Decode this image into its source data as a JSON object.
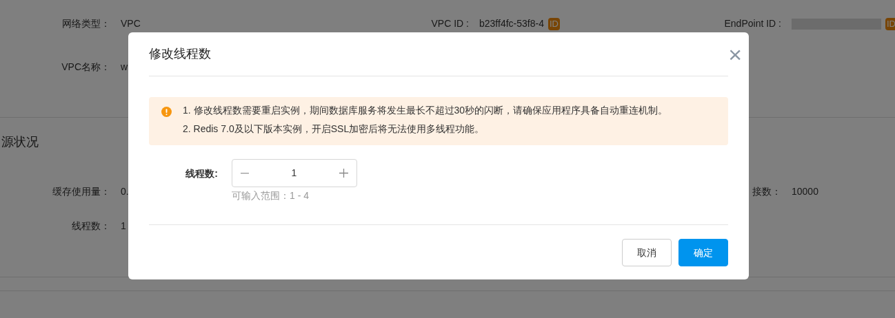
{
  "background": {
    "network_rows": [
      [
        {
          "label": "网络类型：",
          "value": "VPC"
        },
        {
          "label": "VPC ID :",
          "value": "b23ff4fc-53f8-4",
          "badge": "ID"
        },
        {
          "label": "EndPoint ID :",
          "badge": "ID"
        }
      ],
      [
        {
          "label": "VPC名称：",
          "value": "w"
        }
      ]
    ],
    "section_title": "源状况",
    "resource_rows": [
      [
        {
          "label": "缓存使用量：",
          "value": "0."
        },
        {
          "label": "接数：",
          "value": "10000"
        }
      ],
      [
        {
          "label": "线程数：",
          "value": "1"
        }
      ]
    ]
  },
  "dialog": {
    "title": "修改线程数",
    "close": "×",
    "alert": {
      "lines": [
        "1. 修改线程数需要重启实例，期间数据库服务将发生最长不超过30秒的闪断，请确保应用程序具备自动重连机制。",
        "2. Redis 7.0及以下版本实例，开启SSL加密后将无法使用多线程功能。"
      ]
    },
    "field": {
      "label": "线程数:",
      "value": "1",
      "hint": "可输入范围：1 - 4"
    },
    "buttons": [
      {
        "label": "取消",
        "kind": "secondary"
      },
      {
        "label": "确定",
        "kind": "primary"
      }
    ]
  }
}
